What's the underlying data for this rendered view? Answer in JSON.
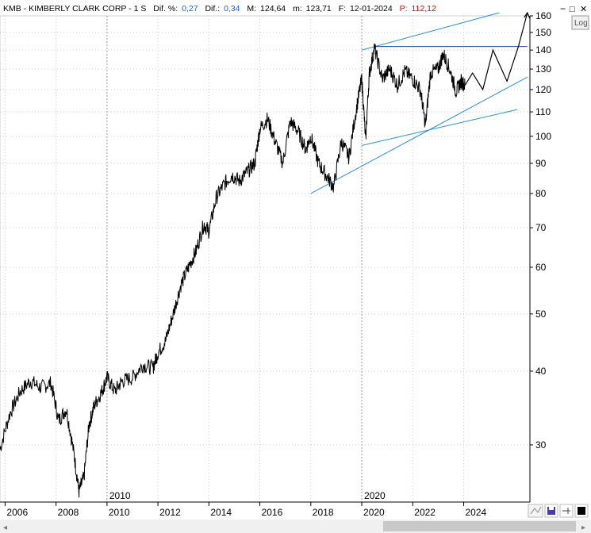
{
  "header": {
    "symbol": "KMB",
    "name": "KIMBERLY CLARK CORP",
    "period": "1 S",
    "dif_pct_label": "Dif. %:",
    "dif_pct_value": "0,27",
    "dif_label": "Dif.:",
    "dif_value": "0,34",
    "max_label": "M:",
    "max_value": "124,64",
    "min_label": "m:",
    "min_value": "123,71",
    "date_label": "F:",
    "date_value": "12-01-2024",
    "price_label": "P:",
    "price_value": "112,12"
  },
  "window_controls": {
    "minimize": "−",
    "restore": "□",
    "close": "✕"
  },
  "scale_button": "Log",
  "colors": {
    "price": "#000000",
    "trendline": "#2a8fd0",
    "header_value": "#1a5fd0",
    "header_price": "#e00000",
    "grid": "#c8c8c8"
  },
  "chart_data": {
    "type": "line",
    "y_scale": "log",
    "ylim": [
      24,
      160
    ],
    "xlim": [
      2005.8,
      2026.6
    ],
    "y_ticks": [
      30,
      40,
      50,
      60,
      70,
      80,
      90,
      100,
      110,
      120,
      130,
      140,
      150,
      160
    ],
    "y_tick_labels": [
      "30",
      "40",
      "50",
      "60",
      "70",
      "80",
      "90",
      "100",
      "110",
      "120",
      "130",
      "140",
      "150",
      "160"
    ],
    "x_ticks": [
      2006,
      2008,
      2010,
      2012,
      2014,
      2016,
      2018,
      2020,
      2022,
      2024
    ],
    "x_tick_labels": [
      "2006",
      "2008",
      "2010",
      "2012",
      "2014",
      "2016",
      "2018",
      "2020",
      "2022",
      "2024"
    ],
    "era_markers": [
      {
        "x": 2010,
        "label": "2010"
      },
      {
        "x": 2020,
        "label": "2020"
      }
    ],
    "grid": true,
    "series": [
      {
        "kind": "price",
        "x": [
          2005.8,
          2006.2,
          2006.6,
          2007.0,
          2007.4,
          2007.8,
          2008.1,
          2008.4,
          2008.7,
          2008.9,
          2009.1,
          2009.3,
          2009.5,
          2009.8,
          2010.0,
          2010.3,
          2010.6,
          2011.0,
          2011.4,
          2011.8,
          2012.0,
          2012.3,
          2012.6,
          2012.9,
          2013.2,
          2013.5,
          2013.8,
          2014.0,
          2014.3,
          2014.6,
          2014.9,
          2015.2,
          2015.5,
          2015.8,
          2016.0,
          2016.3,
          2016.6,
          2016.9,
          2017.2,
          2017.5,
          2017.8,
          2018.0,
          2018.3,
          2018.6,
          2018.9,
          2019.2,
          2019.5,
          2019.8,
          2020.0,
          2020.15,
          2020.3,
          2020.5,
          2020.8,
          2021.1,
          2021.4,
          2021.7,
          2022.0,
          2022.3,
          2022.5,
          2022.7,
          2023.0,
          2023.2,
          2023.45,
          2023.7,
          2023.9,
          2024.05
        ],
        "y": [
          29.5,
          34.0,
          37.0,
          38.5,
          37.5,
          38.2,
          33.0,
          34.5,
          29.0,
          25.0,
          26.5,
          32.5,
          35.0,
          37.0,
          39.0,
          37.0,
          38.5,
          39.0,
          41.0,
          40.5,
          43.0,
          45.0,
          50.0,
          56.0,
          60.0,
          64.0,
          71.0,
          69.0,
          79.0,
          83.0,
          86.0,
          84.0,
          87.0,
          90.0,
          103.0,
          107.0,
          98.0,
          90.0,
          106.0,
          102.0,
          95.0,
          100.0,
          90.0,
          86.0,
          82.0,
          98.0,
          92.0,
          112.0,
          125.0,
          98.0,
          128.0,
          141.0,
          125.0,
          130.0,
          122.0,
          129.0,
          125.0,
          120.0,
          104.0,
          128.0,
          130.0,
          138.0,
          130.0,
          119.0,
          124.0,
          122.0
        ]
      },
      {
        "kind": "projection",
        "x": [
          2024.05,
          2024.35,
          2024.75,
          2025.15,
          2025.7,
          2026.15,
          2026.5
        ],
        "y": [
          122.0,
          128.0,
          120.0,
          140.0,
          124.0,
          142.0,
          162.0
        ]
      }
    ],
    "trendlines": [
      {
        "x": [
          2018.0,
          2026.5
        ],
        "y": [
          80.0,
          126.0
        ]
      },
      {
        "x": [
          2020.0,
          2026.1
        ],
        "y": [
          96.5,
          111.0
        ]
      },
      {
        "x": [
          2020.0,
          2025.4
        ],
        "y": [
          140.0,
          162.0
        ]
      },
      {
        "x": [
          2020.5,
          2026.5
        ],
        "y": [
          142.0,
          142.0
        ],
        "color": "#1a3fa0"
      }
    ]
  }
}
